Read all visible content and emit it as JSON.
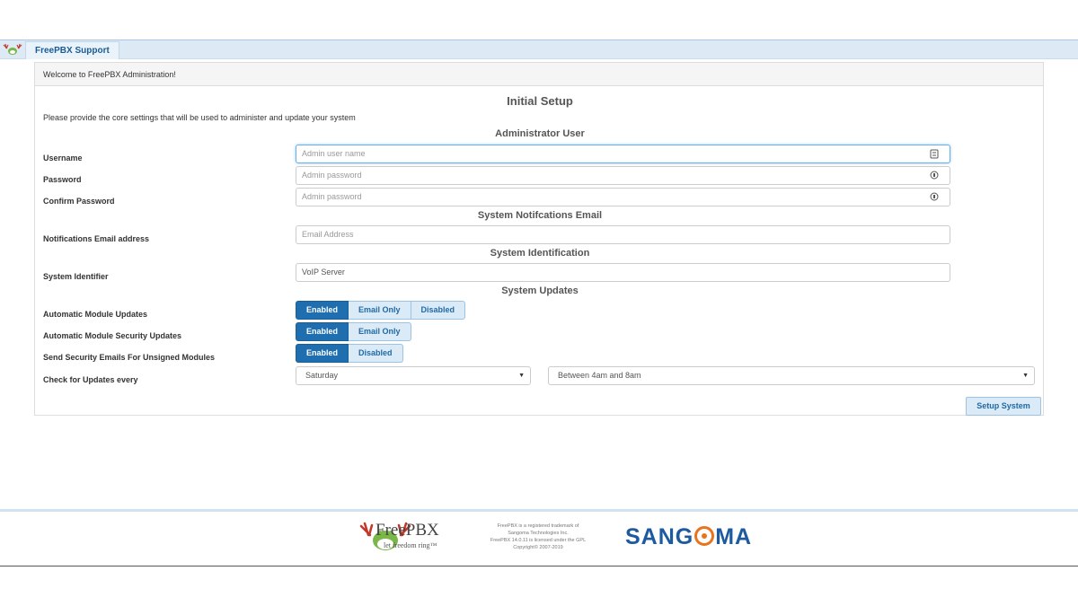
{
  "topbar": {
    "support_tab": "FreePBX Support"
  },
  "panel": {
    "header": "Welcome to FreePBX Administration!",
    "title": "Initial Setup",
    "intro": "Please provide the core settings that will be used to administer and update your system",
    "sections": {
      "admin": "Administrator User",
      "email": "System Notifcations Email",
      "identity": "System Identification",
      "updates": "System Updates"
    },
    "fields": {
      "username": {
        "label": "Username",
        "placeholder": "Admin user name",
        "value": ""
      },
      "password": {
        "label": "Password",
        "placeholder": "Admin password",
        "value": ""
      },
      "confirm": {
        "label": "Confirm Password",
        "placeholder": "Admin password",
        "value": ""
      },
      "email": {
        "label": "Notifications Email address",
        "placeholder": "Email Address",
        "value": ""
      },
      "identifier": {
        "label": "System Identifier",
        "placeholder": "",
        "value": "VoIP Server"
      }
    },
    "updates": {
      "module_updates": {
        "label": "Automatic Module Updates",
        "options": [
          "Enabled",
          "Email Only",
          "Disabled"
        ],
        "selected": "Enabled"
      },
      "security_updates": {
        "label": "Automatic Module Security Updates",
        "options": [
          "Enabled",
          "Email Only"
        ],
        "selected": "Enabled"
      },
      "unsigned_emails": {
        "label": "Send Security Emails For Unsigned Modules",
        "options": [
          "Enabled",
          "Disabled"
        ],
        "selected": "Enabled"
      },
      "check_every": {
        "label": "Check for Updates every",
        "day": "Saturday",
        "time": "Between 4am and 8am"
      }
    },
    "setup_button": "Setup System"
  },
  "footer": {
    "freepbx_name": "FreePBX",
    "freepbx_tagline": "let freedom ring™",
    "legal": [
      "FreePBX is a registered trademark of",
      "Sangoma Technologies Inc.",
      "FreePBX 14.0.11 is licensed under the GPL",
      "Copyright© 2007-2019"
    ],
    "sangoma_logo": "SANGOMA"
  },
  "colors": {
    "accent": "#1f6fb0",
    "brand_orange": "#e8741f",
    "topbar": "#dde9f5"
  }
}
